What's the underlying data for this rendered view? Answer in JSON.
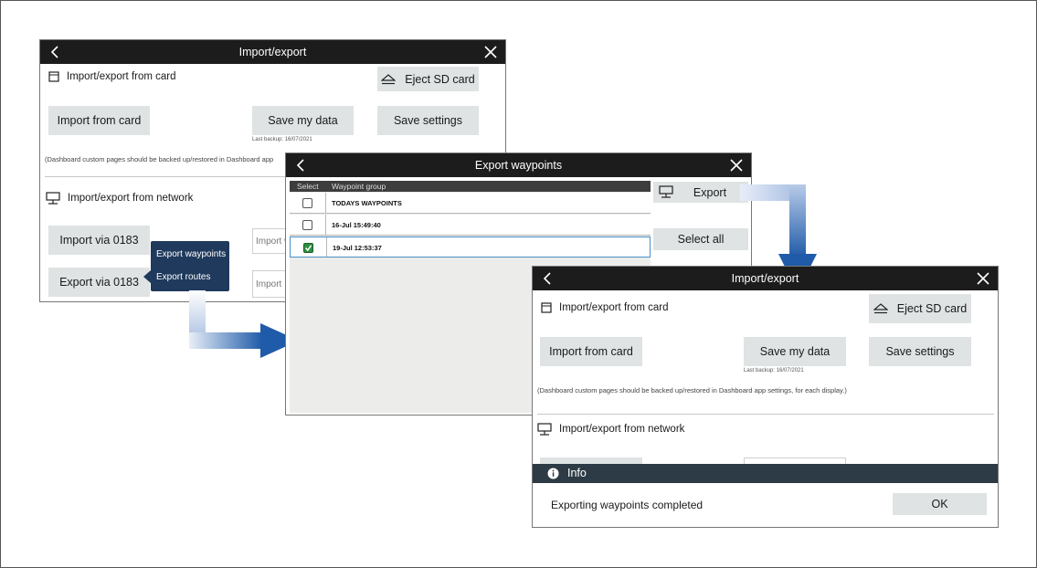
{
  "win1": {
    "title": "Import/export",
    "card_section": "Import/export from card",
    "eject": "Eject SD card",
    "import_card": "Import from card",
    "save_data": "Save my data",
    "save_settings": "Save settings",
    "last_backup": "Last backup: 16/07/2021",
    "note": "(Dashboard custom pages should be backed up/restored in Dashboard app",
    "network_section": "Import/export from network",
    "import_0183": "Import via 0183",
    "export_0183": "Export via 0183",
    "import_field": "Import w",
    "import_field2": "Import",
    "popup": {
      "item1": "Export waypoints",
      "item2": "Export routes"
    }
  },
  "win2": {
    "title": "Export waypoints",
    "col_select": "Select",
    "col_group": "Waypoint group",
    "rows": [
      {
        "label": "TODAYS WAYPOINTS",
        "checked": false
      },
      {
        "label": "16-Jul 15:49:40",
        "checked": false
      },
      {
        "label": "19-Jul 12:53:37",
        "checked": true
      }
    ],
    "export": "Export",
    "select_all": "Select all"
  },
  "win3": {
    "title": "Import/export",
    "card_section": "Import/export from card",
    "eject": "Eject SD card",
    "import_card": "Import from card",
    "save_data": "Save my data",
    "save_settings": "Save settings",
    "last_backup": "Last backup: 16/07/2021",
    "note": "(Dashboard custom pages should be backed up/restored in Dashboard app settings, for each display.)",
    "network_section": "Import/export from network",
    "info_title": "Info",
    "info_message": "Exporting waypoints completed",
    "ok": "OK"
  },
  "colors": {
    "titlebar": "#1c1c1c",
    "button": "#dfe3e3",
    "popup": "#1f3a5c",
    "arrow": "#1f5ba8",
    "check": "#2c8f3f"
  }
}
